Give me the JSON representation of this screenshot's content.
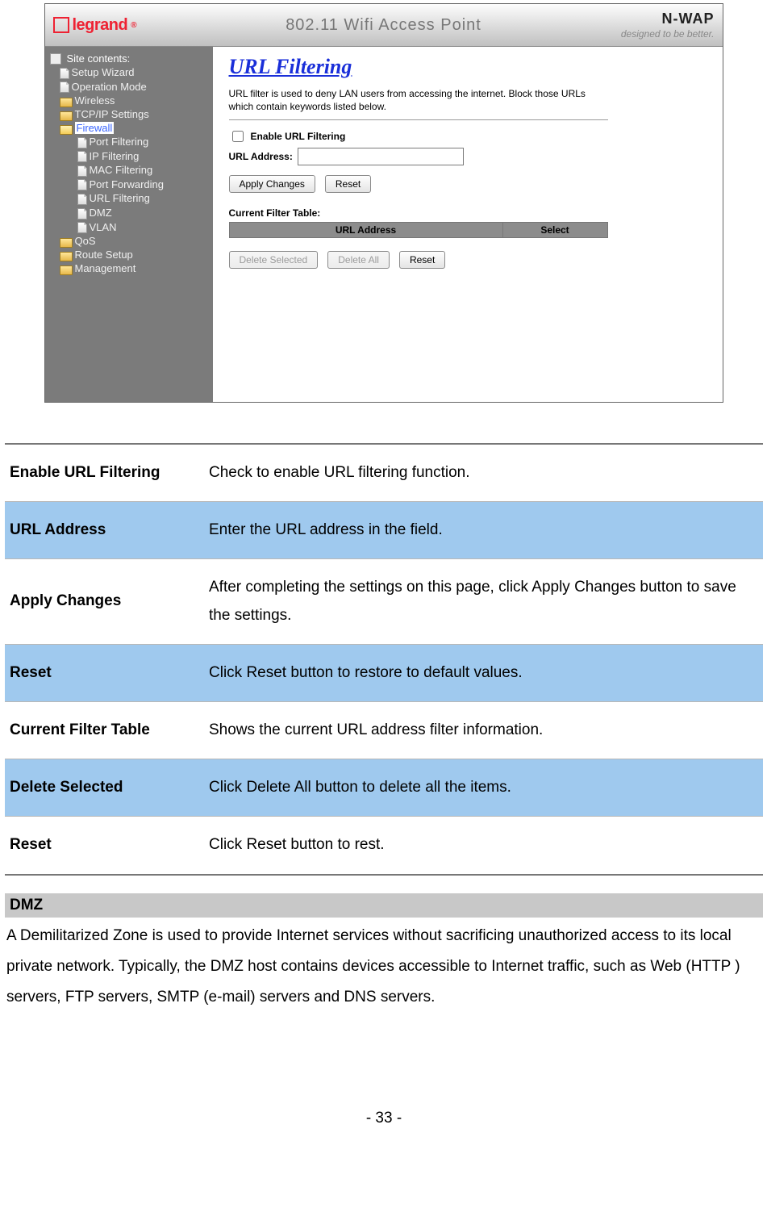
{
  "screenshot": {
    "header": {
      "logo_text": "legrand",
      "logo_reg": "®",
      "center_title": "802.11 Wifi Access Point",
      "brand": "N-WAP",
      "tagline": "designed to be better."
    },
    "sidebar": {
      "heading": "Site contents:",
      "items_lvl1_a": [
        "Setup Wizard",
        "Operation Mode",
        "Wireless",
        "TCP/IP Settings"
      ],
      "firewall_label": "Firewall",
      "items_lvl2": [
        "Port Filtering",
        "IP Filtering",
        "MAC Filtering",
        "Port Forwarding",
        "URL Filtering",
        "DMZ",
        "VLAN"
      ],
      "items_lvl1_b": [
        "QoS",
        "Route Setup",
        "Management"
      ]
    },
    "content": {
      "title": "URL Filtering",
      "description": "URL filter is used to deny LAN users from accessing the internet. Block those URLs which contain keywords listed below.",
      "enable_label": "Enable URL Filtering",
      "url_label": "URL Address:",
      "url_value": "",
      "apply_btn": "Apply Changes",
      "reset_btn": "Reset",
      "table_heading": "Current Filter Table:",
      "th_url": "URL Address",
      "th_select": "Select",
      "delete_selected_btn": "Delete Selected",
      "delete_all_btn": "Delete All",
      "reset2_btn": "Reset"
    }
  },
  "doc_table": {
    "rows": [
      {
        "hl": false,
        "k": "Enable URL Filtering",
        "v": "Check to enable URL filtering function."
      },
      {
        "hl": true,
        "k": "URL Address",
        "v": "Enter the URL address in the field."
      },
      {
        "hl": false,
        "k": "Apply Changes",
        "v": "After completing the settings on this page, click Apply Changes button to save the settings."
      },
      {
        "hl": true,
        "k": "Reset",
        "v": "Click Reset button to restore to default values."
      },
      {
        "hl": false,
        "k": "Current Filter Table",
        "v": "Shows the current URL address filter information."
      },
      {
        "hl": true,
        "k": "Delete Selected",
        "v": "Click Delete All button to delete all the items."
      },
      {
        "hl": false,
        "k": "Reset",
        "v": "Click Reset button to rest."
      }
    ]
  },
  "dmz": {
    "heading": "DMZ",
    "body": "A Demilitarized Zone is used to provide Internet services without sacrificing unauthorized access to its local private network. Typically, the DMZ host contains devices accessible to Internet traffic, such as Web (HTTP ) servers, FTP servers, SMTP (e-mail) servers and DNS servers."
  },
  "page_number": "- 33 -"
}
